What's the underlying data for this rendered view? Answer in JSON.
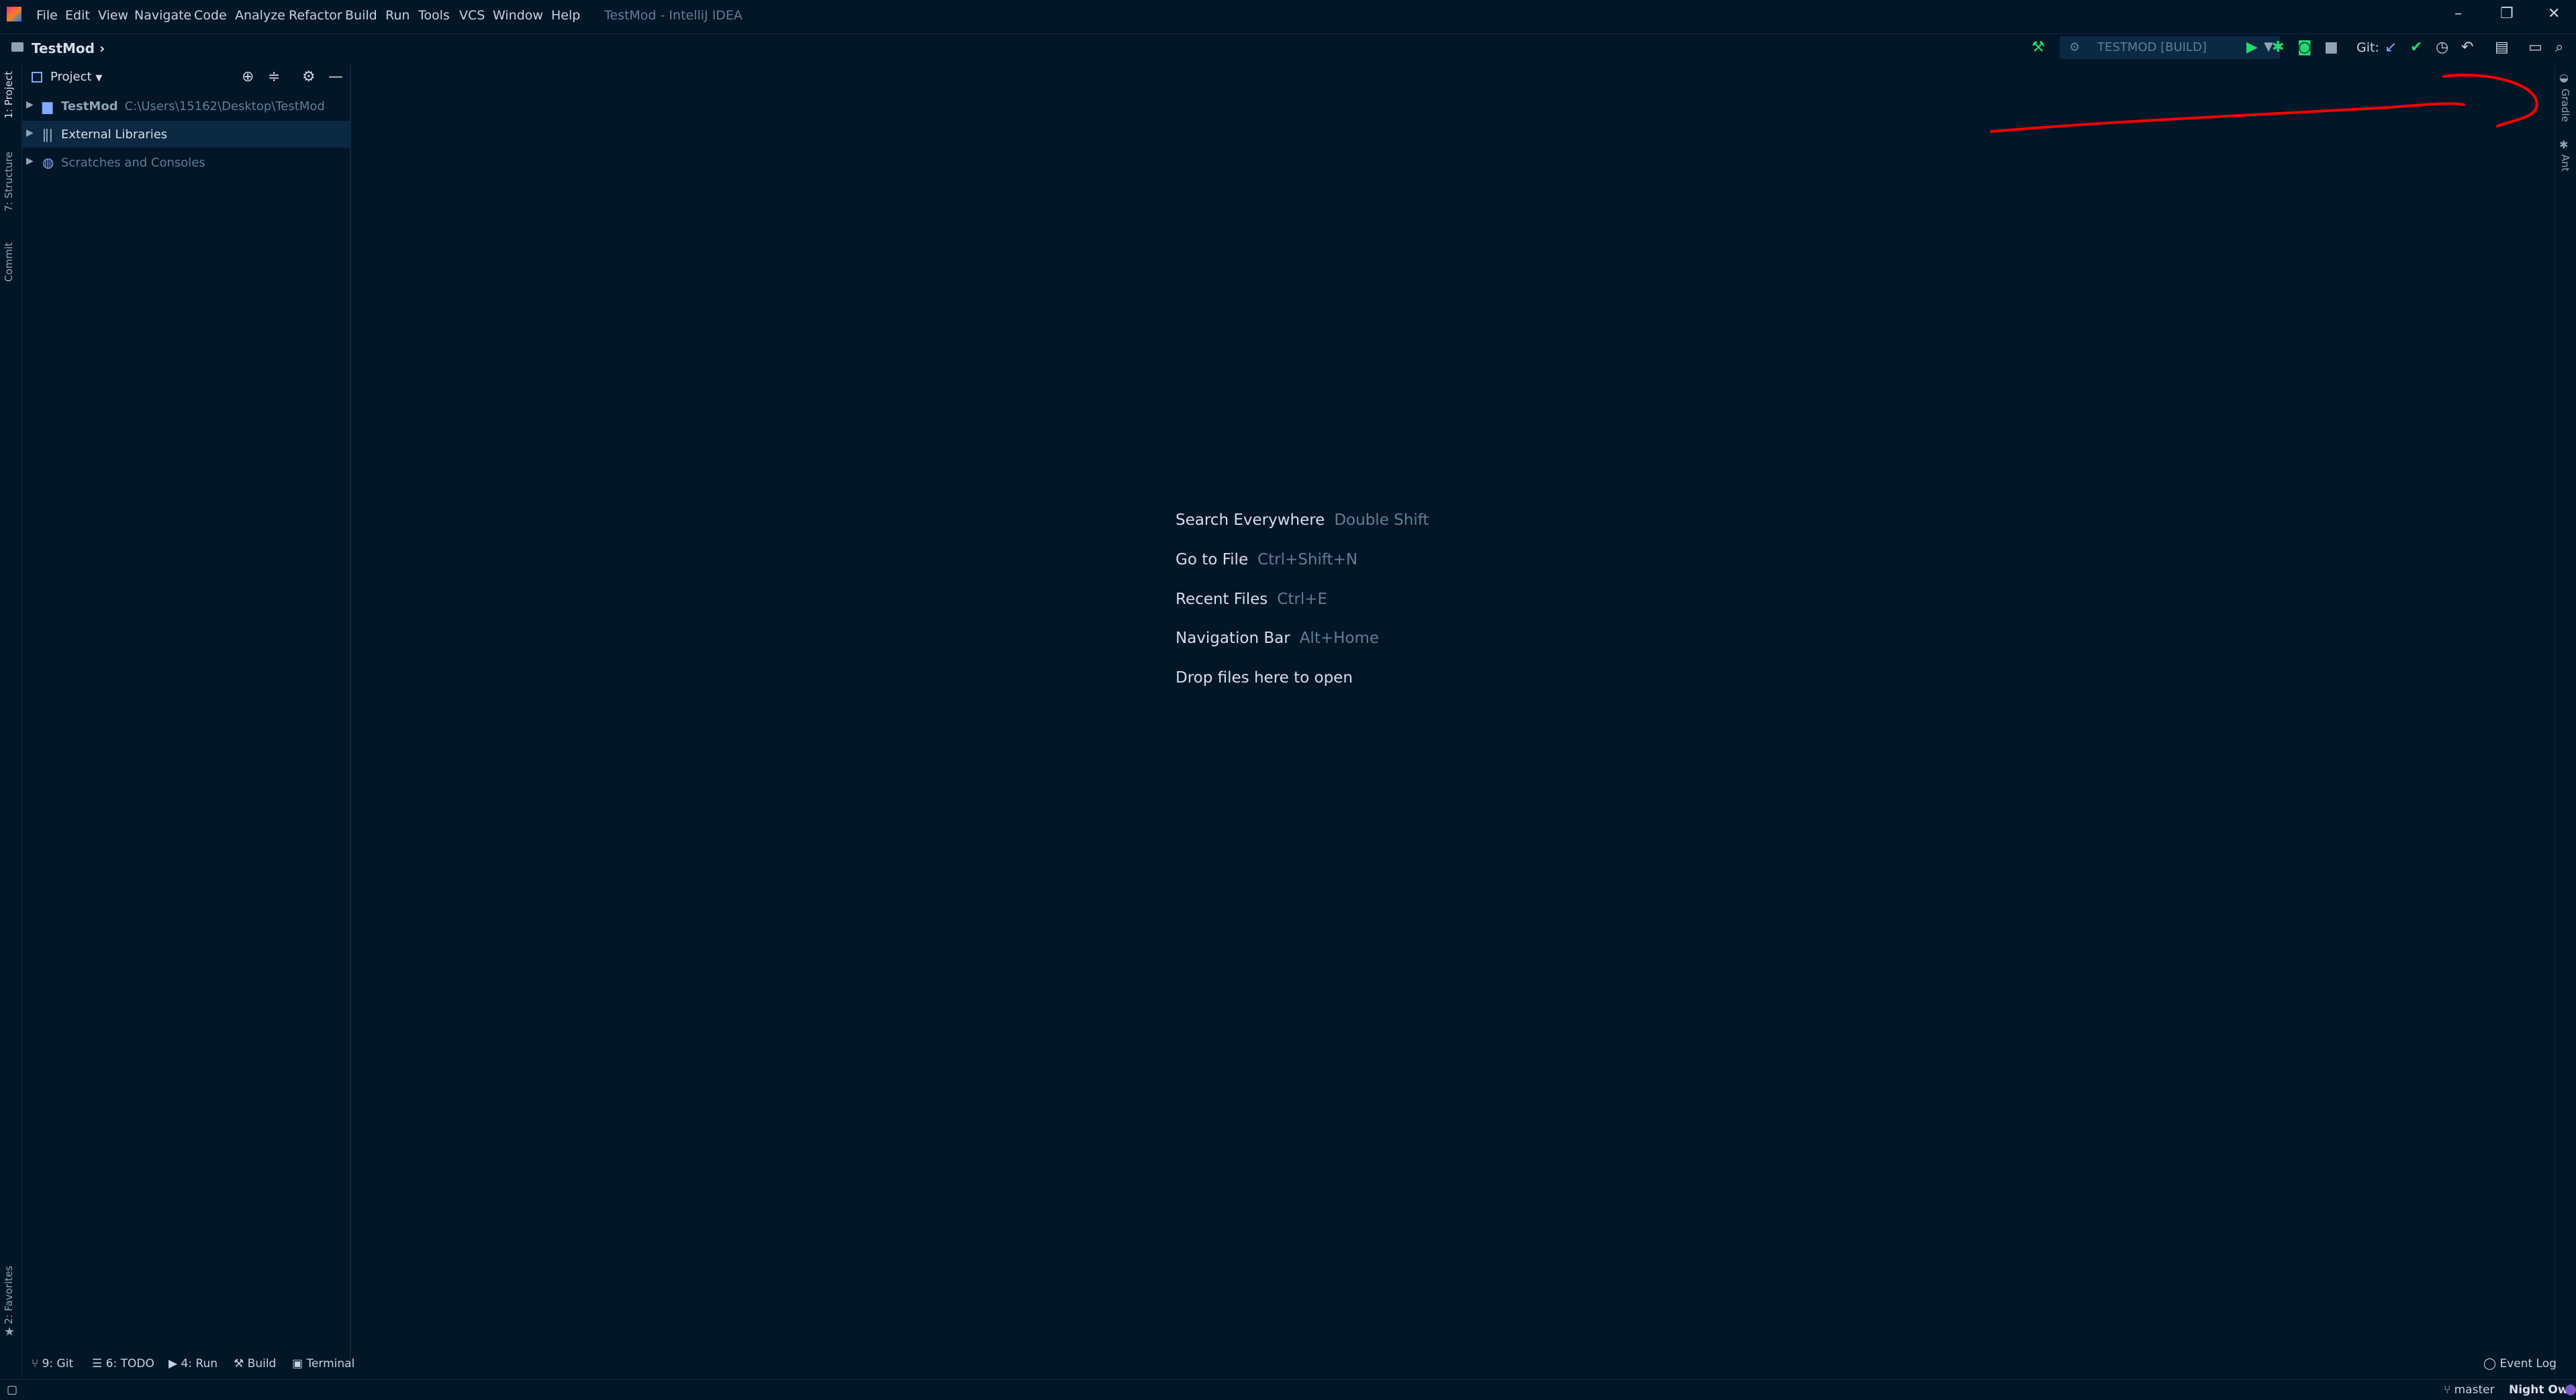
{
  "menu": {
    "items": [
      "File",
      "Edit",
      "View",
      "Navigate",
      "Code",
      "Analyze",
      "Refactor",
      "Build",
      "Run",
      "Tools",
      "VCS",
      "Window",
      "Help"
    ],
    "app_title": "TestMod - IntelliJ IDEA"
  },
  "navbar": {
    "breadcrumb": "TestMod",
    "breadcrumb_arrow": "›",
    "run_config": "TESTMOD [BUILD]",
    "git_label": "Git:"
  },
  "left_stripe": {
    "project_tab": "1: Project",
    "structure_tab": "7: Structure",
    "commit_tab": "Commit",
    "favorites_tab": "2: Favorites"
  },
  "right_stripe": {
    "gradle_tab": "Gradle",
    "ant_tab": "Ant"
  },
  "project_panel": {
    "title": "Project",
    "tree": [
      {
        "label": "TestMod",
        "path": "C:\\Users\\15162\\Desktop\\TestMod"
      },
      {
        "label": "External Libraries",
        "path": ""
      },
      {
        "label": "Scratches and Consoles",
        "path": ""
      }
    ]
  },
  "editor_hints": [
    {
      "action": "Search Everywhere",
      "key": "Double Shift"
    },
    {
      "action": "Go to File",
      "key": "Ctrl+Shift+N"
    },
    {
      "action": "Recent Files",
      "key": "Ctrl+E"
    },
    {
      "action": "Navigation Bar",
      "key": "Alt+Home"
    },
    {
      "action": "Drop files here to open",
      "key": ""
    }
  ],
  "bottom_tools": {
    "git": "9: Git",
    "todo": "6: TODO",
    "run": "4: Run",
    "build": "Build",
    "terminal": "Terminal",
    "event_log": "Event Log"
  },
  "status": {
    "branch": "master",
    "theme": "Night Owl"
  },
  "colors": {
    "background": "#011627",
    "panel_border": "#0b2942",
    "text": "#d6deeb",
    "muted": "#5f7e97",
    "run_green": "#22da6e",
    "annotation_red": "#ff0000"
  }
}
